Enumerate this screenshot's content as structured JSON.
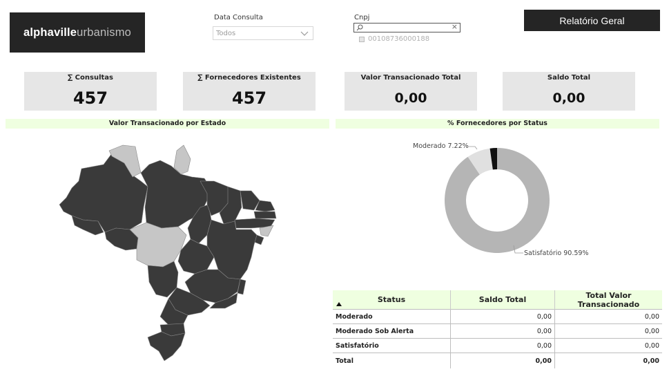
{
  "logo": {
    "bold": "alphaville",
    "light": "urbanismo"
  },
  "filters": {
    "data_consulta": {
      "label": "Data Consulta",
      "value": "Todos"
    },
    "cnpj": {
      "label": "Cnpj",
      "search_value": "",
      "option": "00108736000188"
    }
  },
  "report_button": "Relatório Geral",
  "cards": [
    {
      "title": "∑ Consultas",
      "value": "457"
    },
    {
      "title": "∑ Fornecedores Existentes",
      "value": "457"
    },
    {
      "title": "Valor Transacionado Total",
      "value": "0,00"
    },
    {
      "title": "Saldo Total",
      "value": "0,00"
    }
  ],
  "sections": {
    "map_title": "Valor Transacionado por Estado",
    "donut_title": "% Fornecedores por Status"
  },
  "colors": {
    "state_dark": "#3a3a3a",
    "state_light": "#c6c6c6",
    "donut_satisfatorio": "#b5b5b5",
    "donut_moderado": "#e0e0e0",
    "donut_moderado_alerta": "#111111",
    "header_green": "#efffe0"
  },
  "chart_data": {
    "type": "pie",
    "title": "% Fornecedores por Status",
    "categories": [
      "Satisfatório",
      "Moderado",
      "Moderado Sob Alerta"
    ],
    "values": [
      90.59,
      7.22,
      2.19
    ],
    "labels": [
      "Satisfatório 90.59%",
      "Moderado 7.22%"
    ]
  },
  "table": {
    "headers": [
      "Status",
      "Saldo Total",
      "Total Valor Transacionado"
    ],
    "sort_icon": "sort-ascending-icon",
    "rows": [
      [
        "Moderado",
        "0,00",
        "0,00"
      ],
      [
        "Moderado Sob Alerta",
        "0,00",
        "0,00"
      ],
      [
        "Satisfatório",
        "0,00",
        "0,00"
      ]
    ],
    "total": [
      "Total",
      "0,00",
      "0,00"
    ]
  }
}
